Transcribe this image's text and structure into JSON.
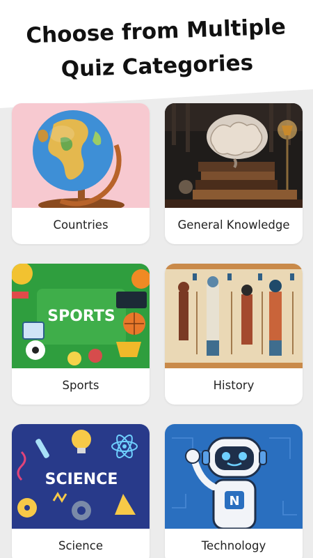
{
  "header": {
    "title": "Choose from Multiple\nQuiz Categories"
  },
  "categories": [
    {
      "label": "Countries",
      "icon": "globe-illustration"
    },
    {
      "label": "General Knowledge",
      "icon": "brain-on-books-illustration"
    },
    {
      "label": "Sports",
      "icon": "sports-equipment-illustration"
    },
    {
      "label": "History",
      "icon": "egyptian-mural-illustration"
    },
    {
      "label": "Science",
      "icon": "science-doodles-illustration"
    },
    {
      "label": "Technology",
      "icon": "robot-illustration"
    }
  ],
  "colors": {
    "background_top": "#ffffff",
    "background_grey": "#ececec",
    "card": "#ffffff",
    "text": "#222222"
  }
}
